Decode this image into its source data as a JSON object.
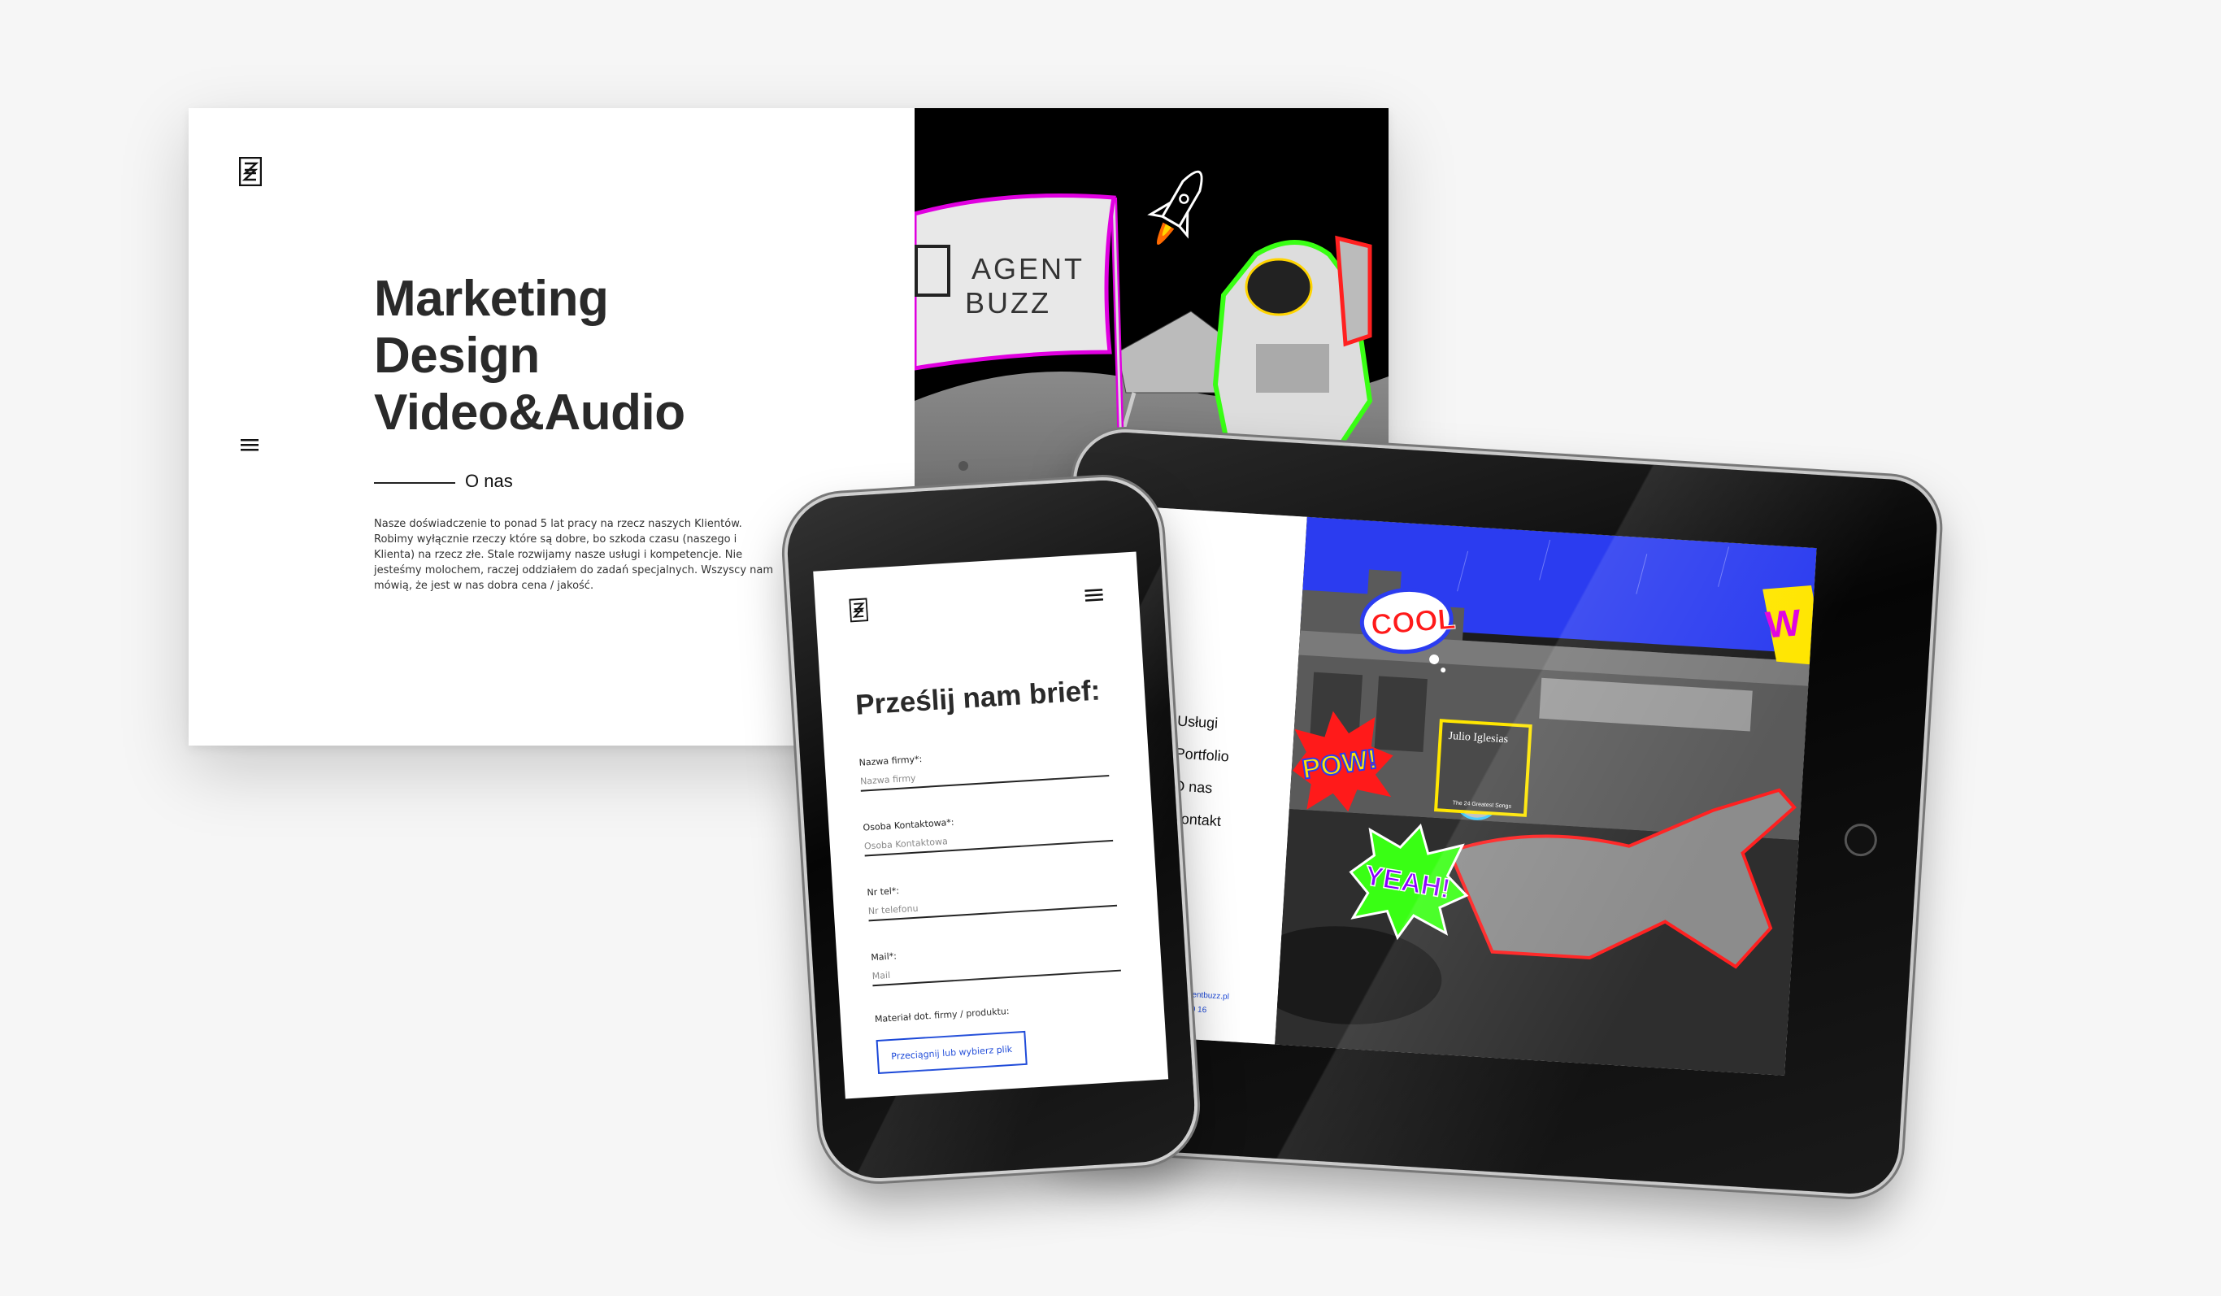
{
  "colors": {
    "background": "#f6f6f6",
    "text": "#2a2a2a",
    "accent_blue": "#1a47d8",
    "neon_green": "#39ff14",
    "magenta": "#e000e0",
    "sky_blue": "#2b3cf0"
  },
  "desktop": {
    "logo_icon": "agentbuzz-z-logo",
    "menu_icon": "hamburger-menu-icon",
    "headline": [
      "Marketing",
      "Design",
      "Video&Audio"
    ],
    "section_label": "O nas",
    "about_text": "Nasze doświadczenie to ponad 5 lat pracy na rzecz naszych Klientów. Robimy wyłącznie rzeczy które są dobre, bo szkoda czasu (naszego i Klienta) na rzecz złe. Stale rozwijamy nasze usługi i kompetencje. Nie jesteśmy molochem, raczej oddziałem do zadań specjalnych. Wszyscy nam mówią, że jest w nas dobra cena / jakość.",
    "flag_text": [
      "AGENT",
      "BUZZ"
    ]
  },
  "tablet": {
    "nav": [
      "Usługi",
      "Portfolio",
      "O nas",
      "Kontakt"
    ],
    "email": "biuro@agentbuzz.pl",
    "phone": "22 404 20 16",
    "stickers": {
      "cool": "COOL",
      "pow": "POW!",
      "yeah": "YEAH!",
      "wow": "W"
    },
    "album": {
      "artist": "Julio Iglesias",
      "subtitle": "The 24 Greatest Songs"
    }
  },
  "phone": {
    "logo_icon": "agentbuzz-z-logo",
    "menu_icon": "hamburger-menu-icon",
    "title": "Prześlij nam brief:",
    "fields": [
      {
        "label": "Nazwa firmy*:",
        "placeholder": "Nazwa firmy"
      },
      {
        "label": "Osoba Kontaktowa*:",
        "placeholder": "Osoba Kontaktowa"
      },
      {
        "label": "Nr tel*:",
        "placeholder": "Nr telefonu"
      },
      {
        "label": "Mail*:",
        "placeholder": "Mail"
      }
    ],
    "material_label": "Materiał dot. firmy / produktu:",
    "upload_button": "Przeciągnij lub wybierz plik"
  }
}
